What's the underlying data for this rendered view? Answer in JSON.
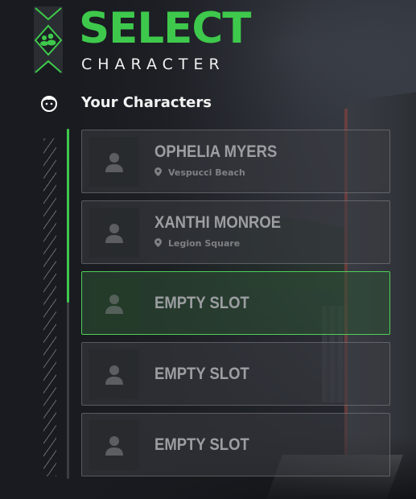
{
  "header": {
    "title": "SELECT",
    "subtitle": "CHARACTER"
  },
  "section": {
    "label": "Your Characters",
    "icon": "face-icon"
  },
  "colors": {
    "accent": "#3ec94c",
    "slot_text": "#9c9ea1",
    "selected_border": "#4fd15a"
  },
  "scroll": {
    "position_fraction": 0.5
  },
  "slots": [
    {
      "name": "OPHELIA MYERS",
      "location": "Vespucci Beach",
      "selected": false
    },
    {
      "name": "XANTHI MONROE",
      "location": "Legion Square",
      "selected": false
    },
    {
      "name": "EMPTY SLOT",
      "location": "",
      "selected": true
    },
    {
      "name": "EMPTY SLOT",
      "location": "",
      "selected": false
    },
    {
      "name": "EMPTY SLOT",
      "location": "",
      "selected": false
    }
  ]
}
